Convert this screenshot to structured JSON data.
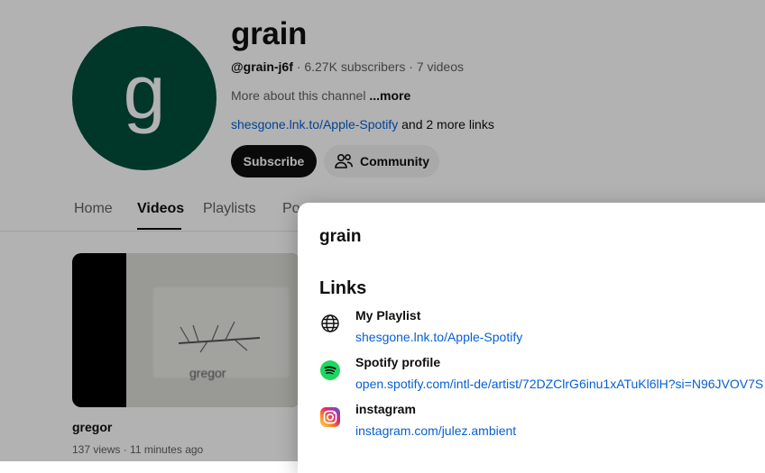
{
  "channel": {
    "avatar_letter": "g",
    "avatar_color": "#00503c",
    "name": "grain",
    "handle": "@grain-j6f",
    "subscribers": "6.27K subscribers",
    "videos": "7 videos",
    "meta_separator": " · ",
    "description": "More about this channel",
    "more_label": "...more",
    "primary_link": "shesgone.lnk.to/Apple-Spotify",
    "more_links": "and 2 more links",
    "subscribe_label": "Subscribe",
    "community_label": "Community"
  },
  "tabs": [
    {
      "label": "Home",
      "active": false
    },
    {
      "label": "Videos",
      "active": true
    },
    {
      "label": "Playlists",
      "active": false
    },
    {
      "label": "Po",
      "active": false
    }
  ],
  "video": {
    "thumbnail_text": "gregor",
    "title": "gregor",
    "views": "137 views",
    "time": "11 minutes ago"
  },
  "dialog": {
    "title": "grain",
    "links_heading": "Links",
    "links": [
      {
        "name": "My Playlist",
        "url": "shesgone.lnk.to/Apple-Spotify",
        "icon": "globe-icon"
      },
      {
        "name": "Spotify profile",
        "url": "open.spotify.com/intl-de/artist/72DZClrG6inu1xATuKl6lH?si=N96JVOV7S",
        "icon": "spotify-icon"
      },
      {
        "name": "instagram",
        "url": "instagram.com/julez.ambient",
        "icon": "instagram-icon"
      }
    ]
  },
  "colors": {
    "link": "#065fd4",
    "spotify": "#1ed760",
    "subscribe_bg": "#0f0f0f"
  }
}
